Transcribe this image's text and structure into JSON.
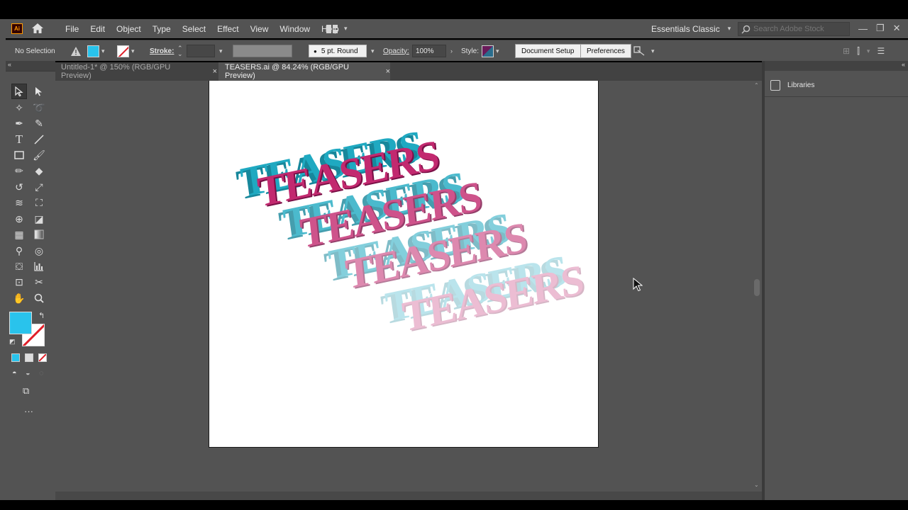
{
  "app": {
    "logo_text": "Ai",
    "menu": [
      "File",
      "Edit",
      "Object",
      "Type",
      "Select",
      "Effect",
      "View",
      "Window",
      "Help"
    ],
    "workspace": "Essentials Classic",
    "search_placeholder": "Search Adobe Stock"
  },
  "controlbar": {
    "selection_status": "No Selection",
    "stroke_label": "Stroke:",
    "brush": "5 pt. Round",
    "opacity_label": "Opacity:",
    "opacity_value": "100%",
    "style_label": "Style:",
    "document_setup": "Document Setup",
    "preferences": "Preferences"
  },
  "tabs": [
    {
      "label": "Untitled-1* @ 150% (RGB/GPU Preview)",
      "active": false
    },
    {
      "label": "TEASERS.ai @ 84.24% (RGB/GPU Preview)",
      "active": true
    }
  ],
  "tab_close": "×",
  "artwork": {
    "word": "TEASERS",
    "copies": 4,
    "face_color": "#c2296f",
    "extrude_color": "#1aa0b8"
  },
  "colors": {
    "fill": "#29c3ec",
    "stroke": "none",
    "accent_app": "#ff9a00"
  },
  "right_panel": {
    "libraries_label": "Libraries"
  }
}
